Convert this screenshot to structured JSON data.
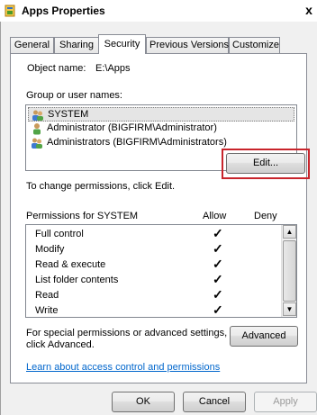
{
  "window": {
    "title": "Apps Properties",
    "close_glyph": "x"
  },
  "tabs": [
    {
      "label": "General"
    },
    {
      "label": "Sharing"
    },
    {
      "label": "Security"
    },
    {
      "label": "Previous Versions"
    },
    {
      "label": "Customize"
    }
  ],
  "active_tab": "Security",
  "object": {
    "label": "Object name:",
    "value": "E:\\Apps"
  },
  "groups": {
    "label": "Group or user names:",
    "items": [
      {
        "name": "SYSTEM",
        "icon": "users-group-icon",
        "selected": true
      },
      {
        "name": "Administrator (BIGFIRM\\Administrator)",
        "icon": "user-icon",
        "selected": false
      },
      {
        "name": "Administrators (BIGFIRM\\Administrators)",
        "icon": "users-group-icon",
        "selected": false
      }
    ]
  },
  "change_permissions": {
    "text": "To change permissions, click Edit.",
    "button": "Edit..."
  },
  "permissions": {
    "header": "Permissions for SYSTEM",
    "allow_header": "Allow",
    "deny_header": "Deny",
    "check_glyph": "✓",
    "rows": [
      {
        "name": "Full control",
        "allow": true,
        "deny": false
      },
      {
        "name": "Modify",
        "allow": true,
        "deny": false
      },
      {
        "name": "Read & execute",
        "allow": true,
        "deny": false
      },
      {
        "name": "List folder contents",
        "allow": true,
        "deny": false
      },
      {
        "name": "Read",
        "allow": true,
        "deny": false
      },
      {
        "name": "Write",
        "allow": true,
        "deny": false
      }
    ]
  },
  "advanced": {
    "text_line1": "For special permissions or advanced settings,",
    "text_line2": "click Advanced.",
    "button": "Advanced"
  },
  "learn_link": "Learn about access control and permissions",
  "footer": {
    "ok": "OK",
    "cancel": "Cancel",
    "apply": "Apply"
  },
  "colors": {
    "highlight": "#c8242b",
    "link": "#0066cc"
  }
}
